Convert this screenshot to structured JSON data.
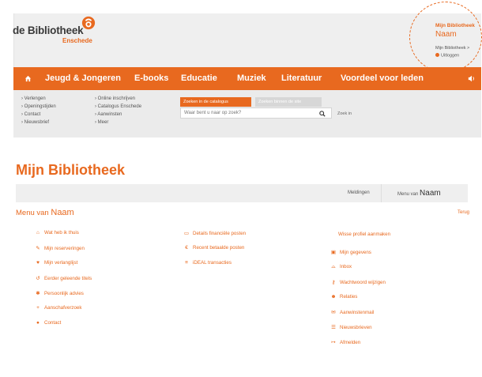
{
  "header": {
    "logo_main": "de Bibliotheek",
    "logo_sub": "Enschede",
    "my_library": {
      "title": "Mijn Bibliotheek",
      "name": "Naam",
      "link": "Mijn Bibliotheek >",
      "logout": "Uitloggen"
    }
  },
  "nav": {
    "home_icon": "home-icon",
    "items": [
      "Jeugd & Jongeren",
      "E-books",
      "Educatie",
      "Muziek",
      "Literatuur",
      "Voordeel voor leden"
    ],
    "speaker_icon": "speaker-icon"
  },
  "sub": {
    "col1": [
      "› Verlengen",
      "› Openingstijden",
      "› Contact",
      "› Nieuwsbrief"
    ],
    "col2": [
      "› Online inschrijven",
      "› Catalogus Enschede",
      "› Aanwinsten",
      "› Meer"
    ],
    "search_catalog": "Zoeken in de catalogus",
    "search_site": "Zoeken binnen de site",
    "search_placeholder": "Waar bent u naar op zoek?",
    "search_help": "Zoek in"
  },
  "main": {
    "title": "Mijn Bibliotheek",
    "meldingen": "Meldingen",
    "menu_van": "Menu van",
    "menu_van_name": "Naam",
    "heading_prefix": "Menu van",
    "heading_name": "Naam",
    "terug": "Terug",
    "col1": [
      {
        "icon": "home-icon",
        "label": "Wat heb ik thuis"
      },
      {
        "icon": "pin-icon",
        "label": "Mijn reserveringen"
      },
      {
        "icon": "heart-icon",
        "label": "Mijn verlanglijst"
      },
      {
        "icon": "history-icon",
        "label": "Eerder geleende titels"
      },
      {
        "icon": "star-icon",
        "label": "Persoonlijk advies"
      },
      {
        "icon": "plus-icon",
        "label": "Aanschafverzoek"
      },
      {
        "icon": "chat-icon",
        "label": "Contact"
      }
    ],
    "col2": [
      {
        "icon": "card-icon",
        "label": "Details financiële posten"
      },
      {
        "icon": "receipt-icon",
        "label": "Recent betaalde posten"
      },
      {
        "icon": "bank-icon",
        "label": "iDEAL transacties"
      }
    ],
    "col3": [
      {
        "icon": "",
        "label": "Wisse profiel aanmaken"
      },
      {
        "icon": "id-icon",
        "label": "Mijn gegevens"
      },
      {
        "icon": "inbox-icon",
        "label": "Inbox"
      },
      {
        "icon": "key-icon",
        "label": "Wachtwoord wijzigen"
      },
      {
        "icon": "people-icon",
        "label": "Relaties"
      },
      {
        "icon": "mail-icon",
        "label": "Aanwinstenmail"
      },
      {
        "icon": "list-icon",
        "label": "Nieuwsbrieven"
      },
      {
        "icon": "logout-icon",
        "label": "Afmelden"
      }
    ]
  }
}
